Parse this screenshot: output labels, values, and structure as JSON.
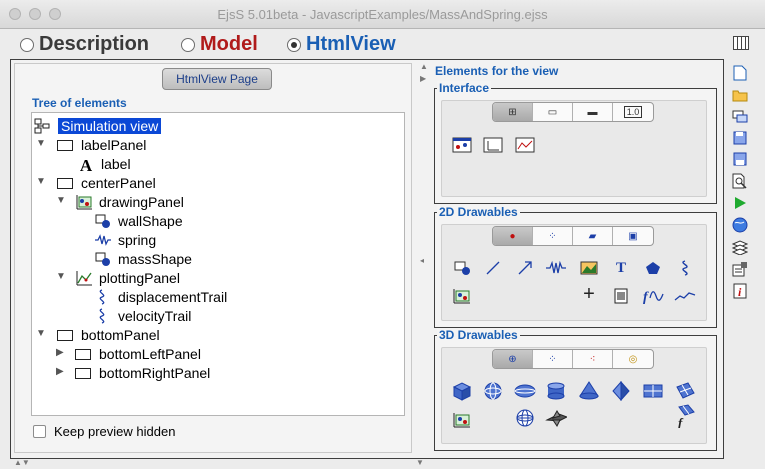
{
  "window": {
    "title": "EjsS 5.01beta - JavascriptExamples/MassAndSpring.ejss"
  },
  "modes": [
    {
      "label": "Description",
      "color": "#3a3a3a",
      "selected": false
    },
    {
      "label": "Model",
      "color": "#b01a1a",
      "selected": false
    },
    {
      "label": "HtmlView",
      "color": "#1a5fb4",
      "selected": true
    }
  ],
  "page_tab": "HtmlView Page",
  "tree": {
    "header": "Tree of elements",
    "nodes": [
      {
        "label": "Simulation view",
        "icon": "simulation-view-icon"
      },
      {
        "label": "labelPanel",
        "icon": "panel-icon"
      },
      {
        "label": "label",
        "icon": "label-a-icon"
      },
      {
        "label": "centerPanel",
        "icon": "panel-icon"
      },
      {
        "label": "drawingPanel",
        "icon": "drawing-panel-icon"
      },
      {
        "label": "wallShape",
        "icon": "shape-icon"
      },
      {
        "label": "spring",
        "icon": "spring-icon"
      },
      {
        "label": "massShape",
        "icon": "shape-icon"
      },
      {
        "label": "plottingPanel",
        "icon": "plotting-panel-icon"
      },
      {
        "label": "displacementTrail",
        "icon": "trail-icon"
      },
      {
        "label": "velocityTrail",
        "icon": "trail-icon"
      },
      {
        "label": "bottomPanel",
        "icon": "panel-icon"
      },
      {
        "label": "bottomLeftPanel",
        "icon": "panel-icon"
      },
      {
        "label": "bottomRightPanel",
        "icon": "panel-icon"
      }
    ]
  },
  "keep_preview": "Keep preview hidden",
  "elements": {
    "title": "Elements for the view",
    "interface": "Interface",
    "drawables2d": "2D Drawables",
    "drawables3d": "3D Drawables",
    "interface_value_tab": "1.0",
    "text_tool": "T",
    "plus_tool": "+"
  },
  "colors": {
    "accent": "#1a5fb4",
    "model": "#b01a1a",
    "selection": "#0b48d6"
  }
}
